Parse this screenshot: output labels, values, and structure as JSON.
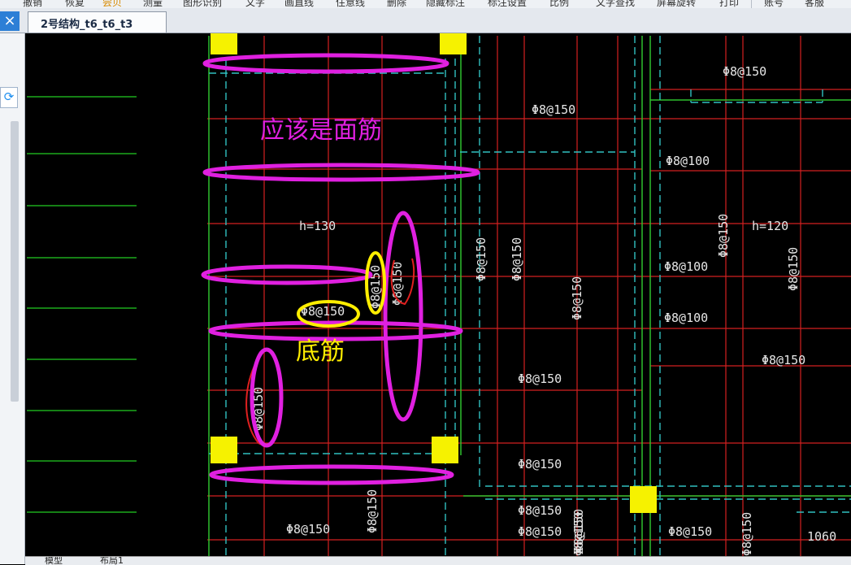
{
  "toolbar": {
    "items": [
      "撤销",
      "恢复",
      "尝贝",
      "测量",
      "图形识别",
      "文字",
      "画直线",
      "住意线",
      "删除",
      "隐藏标注",
      "标注设置",
      "比例",
      "文字查找",
      "屏幕旋转",
      "打印",
      "账号",
      "客服"
    ]
  },
  "tab": {
    "title": "2号结构_t6_t6_t3"
  },
  "left_panel": {
    "close_glyph": "×",
    "sync_glyph": "⟳"
  },
  "drawing": {
    "slab_labels": [
      "h=130",
      "h=120"
    ],
    "rebar_labels_horizontal": [
      "Φ8@150",
      "Φ8@150",
      "Φ8@100",
      "Φ8@100",
      "Φ8@100",
      "Φ8@150",
      "Φ8@150",
      "Φ8@150",
      "Φ8@150",
      "Φ8@150",
      "Φ8@150",
      "Φ8@150",
      "Φ8@150"
    ],
    "rebar_labels_vertical": [
      "Φ8@150",
      "Φ8@150",
      "Φ8@150",
      "Φ8@150",
      "Φ8@150",
      "Φ8@150",
      "Φ8@150",
      "Φ8@150",
      "Φ8@150",
      "Φ8@150",
      "Φ8@150",
      "Φ8@150"
    ],
    "dimension": "1060"
  },
  "annotations": {
    "top_note": "应该是面筋",
    "bottom_note": "底筋",
    "magenta": "#e020e0",
    "yellow": "#ffee00",
    "red": "#e02020"
  },
  "bottom_tabs": [
    "模型",
    "布局1"
  ]
}
